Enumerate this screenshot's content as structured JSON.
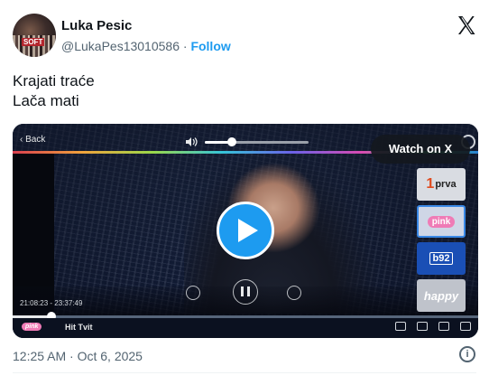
{
  "author": {
    "name": "Luka Pesic",
    "handle": "@LukaPes13010586",
    "separator": "·",
    "follow_label": "Follow",
    "avatar_text": "SOFT"
  },
  "tweet": {
    "lines": [
      "Krajati traće",
      "Lača mati"
    ],
    "timestamp": "12:25 AM · Oct 6, 2025"
  },
  "video": {
    "back_label": "Back",
    "watch_label": "Watch on X",
    "volume_level": 0.25,
    "progress_level": 0.09,
    "time_range": "21:08:23 - 23:37:49",
    "channels": [
      "prva",
      "pink",
      "b92",
      "happy"
    ],
    "channel_number": "1",
    "bottom_logo": "pink",
    "show_name": "Hit Tvit"
  },
  "colors": {
    "accent": "#1d9bf0",
    "secondary_text": "#536471"
  },
  "icons": [
    "x-logo-icon",
    "info-icon",
    "play-icon",
    "pause-icon",
    "rewind-icon",
    "forward-icon",
    "volume-icon",
    "settings-icon"
  ]
}
